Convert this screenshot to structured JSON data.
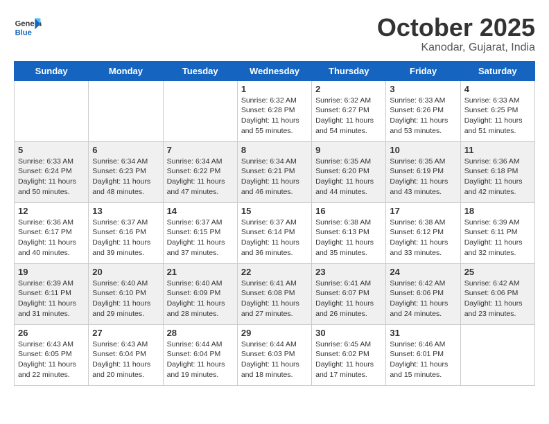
{
  "header": {
    "logo_general": "General",
    "logo_blue": "Blue",
    "month_title": "October 2025",
    "location": "Kanodar, Gujarat, India"
  },
  "weekdays": [
    "Sunday",
    "Monday",
    "Tuesday",
    "Wednesday",
    "Thursday",
    "Friday",
    "Saturday"
  ],
  "weeks": [
    [
      {
        "day": "",
        "info": ""
      },
      {
        "day": "",
        "info": ""
      },
      {
        "day": "",
        "info": ""
      },
      {
        "day": "1",
        "info": "Sunrise: 6:32 AM\nSunset: 6:28 PM\nDaylight: 11 hours\nand 55 minutes."
      },
      {
        "day": "2",
        "info": "Sunrise: 6:32 AM\nSunset: 6:27 PM\nDaylight: 11 hours\nand 54 minutes."
      },
      {
        "day": "3",
        "info": "Sunrise: 6:33 AM\nSunset: 6:26 PM\nDaylight: 11 hours\nand 53 minutes."
      },
      {
        "day": "4",
        "info": "Sunrise: 6:33 AM\nSunset: 6:25 PM\nDaylight: 11 hours\nand 51 minutes."
      }
    ],
    [
      {
        "day": "5",
        "info": "Sunrise: 6:33 AM\nSunset: 6:24 PM\nDaylight: 11 hours\nand 50 minutes."
      },
      {
        "day": "6",
        "info": "Sunrise: 6:34 AM\nSunset: 6:23 PM\nDaylight: 11 hours\nand 48 minutes."
      },
      {
        "day": "7",
        "info": "Sunrise: 6:34 AM\nSunset: 6:22 PM\nDaylight: 11 hours\nand 47 minutes."
      },
      {
        "day": "8",
        "info": "Sunrise: 6:34 AM\nSunset: 6:21 PM\nDaylight: 11 hours\nand 46 minutes."
      },
      {
        "day": "9",
        "info": "Sunrise: 6:35 AM\nSunset: 6:20 PM\nDaylight: 11 hours\nand 44 minutes."
      },
      {
        "day": "10",
        "info": "Sunrise: 6:35 AM\nSunset: 6:19 PM\nDaylight: 11 hours\nand 43 minutes."
      },
      {
        "day": "11",
        "info": "Sunrise: 6:36 AM\nSunset: 6:18 PM\nDaylight: 11 hours\nand 42 minutes."
      }
    ],
    [
      {
        "day": "12",
        "info": "Sunrise: 6:36 AM\nSunset: 6:17 PM\nDaylight: 11 hours\nand 40 minutes."
      },
      {
        "day": "13",
        "info": "Sunrise: 6:37 AM\nSunset: 6:16 PM\nDaylight: 11 hours\nand 39 minutes."
      },
      {
        "day": "14",
        "info": "Sunrise: 6:37 AM\nSunset: 6:15 PM\nDaylight: 11 hours\nand 37 minutes."
      },
      {
        "day": "15",
        "info": "Sunrise: 6:37 AM\nSunset: 6:14 PM\nDaylight: 11 hours\nand 36 minutes."
      },
      {
        "day": "16",
        "info": "Sunrise: 6:38 AM\nSunset: 6:13 PM\nDaylight: 11 hours\nand 35 minutes."
      },
      {
        "day": "17",
        "info": "Sunrise: 6:38 AM\nSunset: 6:12 PM\nDaylight: 11 hours\nand 33 minutes."
      },
      {
        "day": "18",
        "info": "Sunrise: 6:39 AM\nSunset: 6:11 PM\nDaylight: 11 hours\nand 32 minutes."
      }
    ],
    [
      {
        "day": "19",
        "info": "Sunrise: 6:39 AM\nSunset: 6:11 PM\nDaylight: 11 hours\nand 31 minutes."
      },
      {
        "day": "20",
        "info": "Sunrise: 6:40 AM\nSunset: 6:10 PM\nDaylight: 11 hours\nand 29 minutes."
      },
      {
        "day": "21",
        "info": "Sunrise: 6:40 AM\nSunset: 6:09 PM\nDaylight: 11 hours\nand 28 minutes."
      },
      {
        "day": "22",
        "info": "Sunrise: 6:41 AM\nSunset: 6:08 PM\nDaylight: 11 hours\nand 27 minutes."
      },
      {
        "day": "23",
        "info": "Sunrise: 6:41 AM\nSunset: 6:07 PM\nDaylight: 11 hours\nand 26 minutes."
      },
      {
        "day": "24",
        "info": "Sunrise: 6:42 AM\nSunset: 6:06 PM\nDaylight: 11 hours\nand 24 minutes."
      },
      {
        "day": "25",
        "info": "Sunrise: 6:42 AM\nSunset: 6:06 PM\nDaylight: 11 hours\nand 23 minutes."
      }
    ],
    [
      {
        "day": "26",
        "info": "Sunrise: 6:43 AM\nSunset: 6:05 PM\nDaylight: 11 hours\nand 22 minutes."
      },
      {
        "day": "27",
        "info": "Sunrise: 6:43 AM\nSunset: 6:04 PM\nDaylight: 11 hours\nand 20 minutes."
      },
      {
        "day": "28",
        "info": "Sunrise: 6:44 AM\nSunset: 6:04 PM\nDaylight: 11 hours\nand 19 minutes."
      },
      {
        "day": "29",
        "info": "Sunrise: 6:44 AM\nSunset: 6:03 PM\nDaylight: 11 hours\nand 18 minutes."
      },
      {
        "day": "30",
        "info": "Sunrise: 6:45 AM\nSunset: 6:02 PM\nDaylight: 11 hours\nand 17 minutes."
      },
      {
        "day": "31",
        "info": "Sunrise: 6:46 AM\nSunset: 6:01 PM\nDaylight: 11 hours\nand 15 minutes."
      },
      {
        "day": "",
        "info": ""
      }
    ]
  ]
}
